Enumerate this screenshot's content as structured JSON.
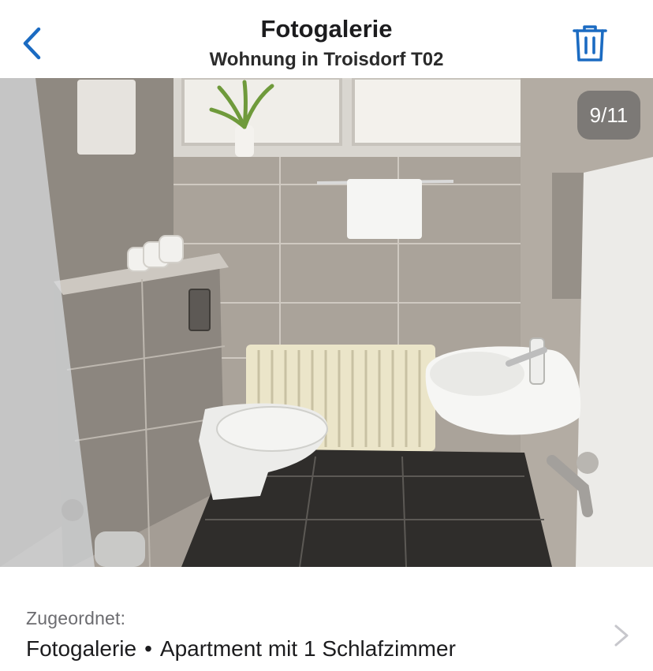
{
  "header": {
    "title": "Fotogalerie",
    "subtitle": "Wohnung in Troisdorf T02",
    "back_icon": "chevron-left-icon",
    "delete_icon": "trash-icon",
    "accent_color": "#1b6bc2"
  },
  "photo": {
    "description_icon": "bathroom-photo",
    "counter": "9/11",
    "current_index": 9,
    "total": 11
  },
  "assignment": {
    "label": "Zugeordnet:",
    "gallery": "Fotogalerie",
    "separator": "•",
    "room": "Apartment mit 1 Schlafzimmer",
    "chevron_icon": "chevron-right-icon"
  }
}
